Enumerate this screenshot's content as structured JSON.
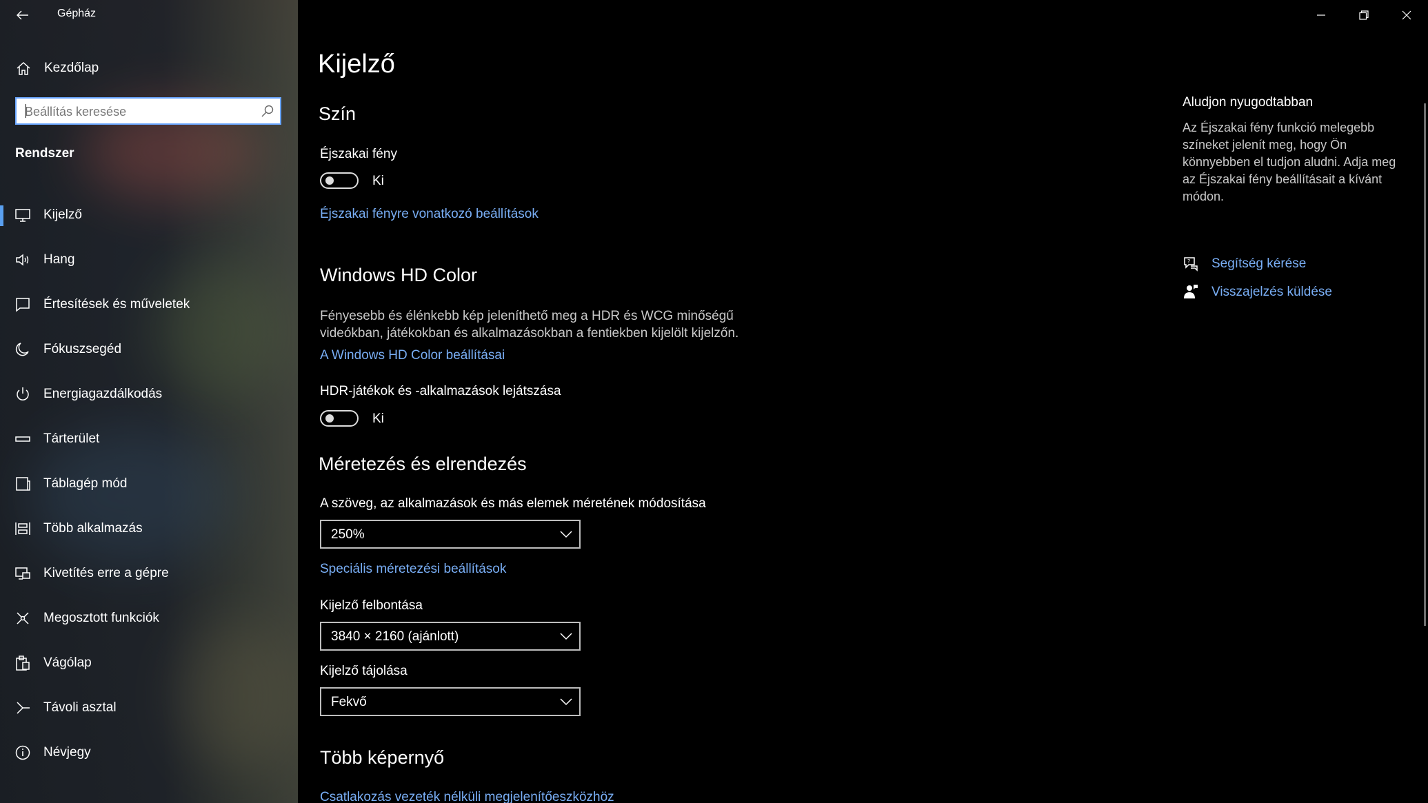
{
  "window": {
    "title": "Gépház",
    "controls": [
      "minimize-icon",
      "restore-icon",
      "close-icon"
    ]
  },
  "sidebar": {
    "home_label": "Kezdőlap",
    "search_placeholder": "Beállítás keresése",
    "section_heading": "Rendszer",
    "items": [
      {
        "label": "Kijelző",
        "icon": "monitor-icon",
        "selected": true
      },
      {
        "label": "Hang",
        "icon": "speaker-icon"
      },
      {
        "label": "Értesítések és műveletek",
        "icon": "notification-icon"
      },
      {
        "label": "Fókuszsegéd",
        "icon": "moon-icon"
      },
      {
        "label": "Energiagazdálkodás",
        "icon": "power-icon"
      },
      {
        "label": "Tárterület",
        "icon": "storage-icon"
      },
      {
        "label": "Táblagép mód",
        "icon": "tablet-icon"
      },
      {
        "label": "Több alkalmazás",
        "icon": "multitasking-icon"
      },
      {
        "label": "Kivetítés erre a gépre",
        "icon": "projecting-icon"
      },
      {
        "label": "Megosztott funkciók",
        "icon": "shared-icon"
      },
      {
        "label": "Vágólap",
        "icon": "clipboard-icon"
      },
      {
        "label": "Távoli asztal",
        "icon": "remote-desktop-icon"
      },
      {
        "label": "Névjegy",
        "icon": "info-icon"
      }
    ]
  },
  "main": {
    "page_title": "Kijelző",
    "color": {
      "heading": "Szín",
      "night_light_label": "Éjszakai fény",
      "night_light_state": "Ki",
      "night_light_link": "Éjszakai fényre vonatkozó beállítások"
    },
    "hdr": {
      "heading": "Windows HD Color",
      "desc_line1": "Fényesebb és élénkebb kép jeleníthető meg a HDR és WCG minőségű",
      "desc_line2": "videókban, játékokban és alkalmazásokban a fentiekben kijelölt kijelzőn.",
      "link": "A Windows HD Color beállításai",
      "hdr_label": "HDR-játékok és -alkalmazások lejátszása",
      "hdr_state": "Ki"
    },
    "scale": {
      "heading": "Méretezés és elrendezés",
      "scale_label": "A szöveg, az alkalmazások és más elemek méretének módosítása",
      "scale_value": "250%",
      "advanced_link": "Speciális méretezési beállítások",
      "resolution_label": "Kijelző felbontása",
      "resolution_value": "3840 × 2160 (ajánlott)",
      "orientation_label": "Kijelző tájolása",
      "orientation_value": "Fekvő"
    },
    "multi": {
      "heading": "Több képernyő",
      "link": "Csatlakozás vezeték nélküli megjelenítőeszközhöz"
    }
  },
  "right_pane": {
    "title": "Aludjon nyugodtabban",
    "desc": "Az Éjszakai fény funkció melegebb színeket jelenít meg, hogy Ön könnyebben el tudjon aludni. Adja meg az Éjszakai fény beállításait a kívánt módon.",
    "help_link": "Segítség kérése",
    "feedback_link": "Visszajelzés küldése"
  },
  "colors": {
    "accent_link": "#79aef5",
    "selection_bar": "#5aa0f0",
    "background": "#000000"
  }
}
